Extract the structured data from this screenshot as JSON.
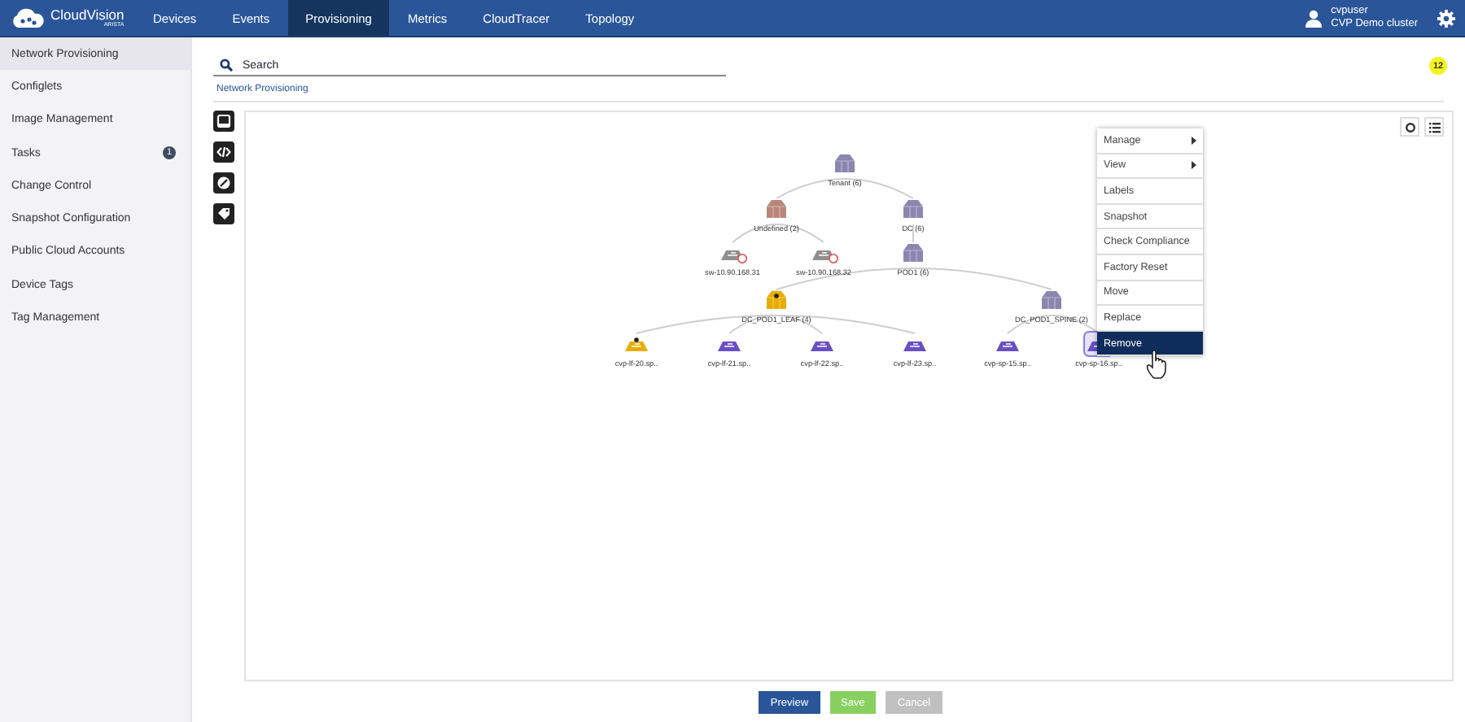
{
  "app": {
    "logo": "CloudVision",
    "logo_sub": "ARISTA"
  },
  "nav": [
    {
      "label": "Devices",
      "selected": false
    },
    {
      "label": "Events",
      "selected": false
    },
    {
      "label": "Provisioning",
      "selected": true
    },
    {
      "label": "Metrics",
      "selected": false
    },
    {
      "label": "CloudTracer",
      "selected": false
    },
    {
      "label": "Topology",
      "selected": false
    }
  ],
  "user": {
    "name": "cvpuser",
    "cluster": "CVP Demo cluster"
  },
  "sidebar": [
    {
      "label": "Network Provisioning",
      "selected": true
    },
    {
      "label": "Configlets",
      "selected": false
    },
    {
      "label": "Image Management",
      "selected": false
    },
    {
      "label": "Tasks",
      "selected": false,
      "badge": "1"
    },
    {
      "label": "Change Control",
      "selected": false
    },
    {
      "label": "Snapshot Configuration",
      "selected": false
    },
    {
      "label": "Public Cloud Accounts",
      "selected": false
    },
    {
      "label": "Device Tags",
      "selected": false
    },
    {
      "label": "Tag Management",
      "selected": false
    }
  ],
  "search": {
    "placeholder": "Search"
  },
  "notification_count": "12",
  "breadcrumb": "Network Provisioning",
  "tree": {
    "label": "Tenant (6)",
    "kind": "container",
    "color": "#8a86b0",
    "alert": false,
    "warning": false,
    "selected": false,
    "children": [
      {
        "label": "Undefined (2)",
        "kind": "container",
        "color": "#b8877a",
        "alert": false,
        "warning": false,
        "selected": false,
        "children": [
          {
            "label": "sw-10.90.168.31",
            "kind": "device",
            "color": "#8f8f8f",
            "alert": true,
            "warning": false,
            "selected": false
          },
          {
            "label": "sw-10.90.168.32",
            "kind": "device",
            "color": "#8f8f8f",
            "alert": true,
            "warning": false,
            "selected": false
          }
        ]
      },
      {
        "label": "DC (6)",
        "kind": "container",
        "color": "#8a86b0",
        "alert": false,
        "warning": false,
        "selected": false,
        "children": [
          {
            "label": "POD1 (6)",
            "kind": "container",
            "color": "#8a86b0",
            "alert": false,
            "warning": false,
            "selected": false,
            "children": [
              {
                "label": "DC_POD1_LEAF (4)",
                "kind": "container",
                "color": "#e8ad00",
                "alert": false,
                "warning": true,
                "selected": false,
                "children": [
                  {
                    "label": "cvp-lf-20.sp..",
                    "kind": "device",
                    "color": "#e8ad00",
                    "alert": false,
                    "warning": true,
                    "selected": false
                  },
                  {
                    "label": "cvp-lf-21.sp..",
                    "kind": "device",
                    "color": "#6a4fc4",
                    "alert": false,
                    "warning": false,
                    "selected": false
                  },
                  {
                    "label": "cvp-lf-22.sp..",
                    "kind": "device",
                    "color": "#6a4fc4",
                    "alert": false,
                    "warning": false,
                    "selected": false
                  },
                  {
                    "label": "cvp-lf-23.sp..",
                    "kind": "device",
                    "color": "#6a4fc4",
                    "alert": false,
                    "warning": false,
                    "selected": false
                  }
                ]
              },
              {
                "label": "DC_POD1_SPINE (2)",
                "kind": "container",
                "color": "#8a86b0",
                "alert": false,
                "warning": false,
                "selected": false,
                "children": [
                  {
                    "label": "cvp-sp-15.sp..",
                    "kind": "device",
                    "color": "#6a4fc4",
                    "alert": false,
                    "warning": false,
                    "selected": false
                  },
                  {
                    "label": "cvp-sp-16.sp..",
                    "kind": "device",
                    "color": "#6a4fc4",
                    "alert": false,
                    "warning": false,
                    "selected": true
                  }
                ]
              }
            ]
          }
        ]
      }
    ]
  },
  "context_menu": [
    {
      "label": "Manage",
      "submenu": true,
      "selected": false
    },
    {
      "label": "View",
      "submenu": true,
      "selected": false
    },
    {
      "label": "Labels",
      "submenu": false,
      "selected": false
    },
    {
      "label": "Snapshot",
      "submenu": false,
      "selected": false
    },
    {
      "label": "Check Compliance",
      "submenu": false,
      "selected": false
    },
    {
      "label": "Factory Reset",
      "submenu": false,
      "selected": false
    },
    {
      "label": "Move",
      "submenu": false,
      "selected": false
    },
    {
      "label": "Replace",
      "submenu": false,
      "selected": false
    },
    {
      "label": "Remove",
      "submenu": false,
      "selected": true
    }
  ],
  "buttons": [
    {
      "label": "Preview",
      "kind": "primary"
    },
    {
      "label": "Save",
      "kind": "success"
    },
    {
      "label": "Cancel",
      "kind": "muted"
    }
  ]
}
